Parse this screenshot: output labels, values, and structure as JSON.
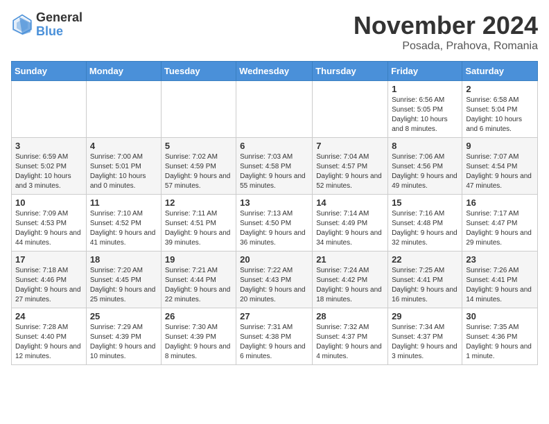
{
  "logo": {
    "general": "General",
    "blue": "Blue"
  },
  "title": "November 2024",
  "location": "Posada, Prahova, Romania",
  "weekdays": [
    "Sunday",
    "Monday",
    "Tuesday",
    "Wednesday",
    "Thursday",
    "Friday",
    "Saturday"
  ],
  "weeks": [
    [
      {
        "day": "",
        "info": ""
      },
      {
        "day": "",
        "info": ""
      },
      {
        "day": "",
        "info": ""
      },
      {
        "day": "",
        "info": ""
      },
      {
        "day": "",
        "info": ""
      },
      {
        "day": "1",
        "info": "Sunrise: 6:56 AM\nSunset: 5:05 PM\nDaylight: 10 hours and 8 minutes."
      },
      {
        "day": "2",
        "info": "Sunrise: 6:58 AM\nSunset: 5:04 PM\nDaylight: 10 hours and 6 minutes."
      }
    ],
    [
      {
        "day": "3",
        "info": "Sunrise: 6:59 AM\nSunset: 5:02 PM\nDaylight: 10 hours and 3 minutes."
      },
      {
        "day": "4",
        "info": "Sunrise: 7:00 AM\nSunset: 5:01 PM\nDaylight: 10 hours and 0 minutes."
      },
      {
        "day": "5",
        "info": "Sunrise: 7:02 AM\nSunset: 4:59 PM\nDaylight: 9 hours and 57 minutes."
      },
      {
        "day": "6",
        "info": "Sunrise: 7:03 AM\nSunset: 4:58 PM\nDaylight: 9 hours and 55 minutes."
      },
      {
        "day": "7",
        "info": "Sunrise: 7:04 AM\nSunset: 4:57 PM\nDaylight: 9 hours and 52 minutes."
      },
      {
        "day": "8",
        "info": "Sunrise: 7:06 AM\nSunset: 4:56 PM\nDaylight: 9 hours and 49 minutes."
      },
      {
        "day": "9",
        "info": "Sunrise: 7:07 AM\nSunset: 4:54 PM\nDaylight: 9 hours and 47 minutes."
      }
    ],
    [
      {
        "day": "10",
        "info": "Sunrise: 7:09 AM\nSunset: 4:53 PM\nDaylight: 9 hours and 44 minutes."
      },
      {
        "day": "11",
        "info": "Sunrise: 7:10 AM\nSunset: 4:52 PM\nDaylight: 9 hours and 41 minutes."
      },
      {
        "day": "12",
        "info": "Sunrise: 7:11 AM\nSunset: 4:51 PM\nDaylight: 9 hours and 39 minutes."
      },
      {
        "day": "13",
        "info": "Sunrise: 7:13 AM\nSunset: 4:50 PM\nDaylight: 9 hours and 36 minutes."
      },
      {
        "day": "14",
        "info": "Sunrise: 7:14 AM\nSunset: 4:49 PM\nDaylight: 9 hours and 34 minutes."
      },
      {
        "day": "15",
        "info": "Sunrise: 7:16 AM\nSunset: 4:48 PM\nDaylight: 9 hours and 32 minutes."
      },
      {
        "day": "16",
        "info": "Sunrise: 7:17 AM\nSunset: 4:47 PM\nDaylight: 9 hours and 29 minutes."
      }
    ],
    [
      {
        "day": "17",
        "info": "Sunrise: 7:18 AM\nSunset: 4:46 PM\nDaylight: 9 hours and 27 minutes."
      },
      {
        "day": "18",
        "info": "Sunrise: 7:20 AM\nSunset: 4:45 PM\nDaylight: 9 hours and 25 minutes."
      },
      {
        "day": "19",
        "info": "Sunrise: 7:21 AM\nSunset: 4:44 PM\nDaylight: 9 hours and 22 minutes."
      },
      {
        "day": "20",
        "info": "Sunrise: 7:22 AM\nSunset: 4:43 PM\nDaylight: 9 hours and 20 minutes."
      },
      {
        "day": "21",
        "info": "Sunrise: 7:24 AM\nSunset: 4:42 PM\nDaylight: 9 hours and 18 minutes."
      },
      {
        "day": "22",
        "info": "Sunrise: 7:25 AM\nSunset: 4:41 PM\nDaylight: 9 hours and 16 minutes."
      },
      {
        "day": "23",
        "info": "Sunrise: 7:26 AM\nSunset: 4:41 PM\nDaylight: 9 hours and 14 minutes."
      }
    ],
    [
      {
        "day": "24",
        "info": "Sunrise: 7:28 AM\nSunset: 4:40 PM\nDaylight: 9 hours and 12 minutes."
      },
      {
        "day": "25",
        "info": "Sunrise: 7:29 AM\nSunset: 4:39 PM\nDaylight: 9 hours and 10 minutes."
      },
      {
        "day": "26",
        "info": "Sunrise: 7:30 AM\nSunset: 4:39 PM\nDaylight: 9 hours and 8 minutes."
      },
      {
        "day": "27",
        "info": "Sunrise: 7:31 AM\nSunset: 4:38 PM\nDaylight: 9 hours and 6 minutes."
      },
      {
        "day": "28",
        "info": "Sunrise: 7:32 AM\nSunset: 4:37 PM\nDaylight: 9 hours and 4 minutes."
      },
      {
        "day": "29",
        "info": "Sunrise: 7:34 AM\nSunset: 4:37 PM\nDaylight: 9 hours and 3 minutes."
      },
      {
        "day": "30",
        "info": "Sunrise: 7:35 AM\nSunset: 4:36 PM\nDaylight: 9 hours and 1 minute."
      }
    ]
  ]
}
